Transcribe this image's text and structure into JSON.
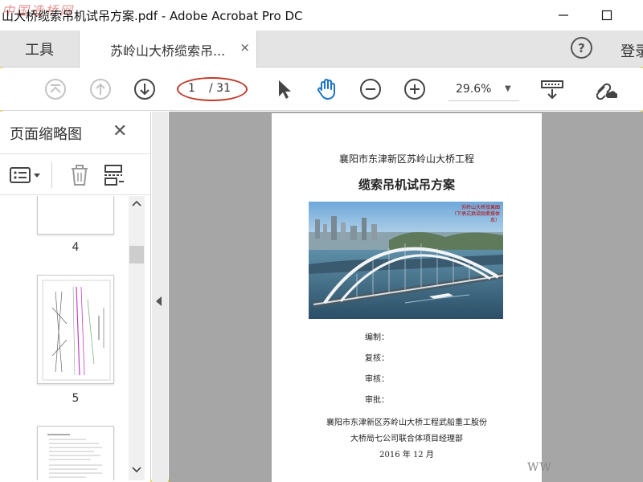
{
  "window": {
    "title": "山大桥缆索吊机试吊方案.pdf - Adobe Acrobat Pro DC",
    "watermark_top": "中国造桥网",
    "minimize_icon": "minimize-icon",
    "maximize_icon": "maximize-icon"
  },
  "tabs": {
    "tools_label": "工具",
    "doc_label": "苏岭山大桥缆索吊...",
    "close_glyph": "×",
    "help_glyph": "?",
    "login_label": "登录"
  },
  "toolbar": {
    "page_current": "1",
    "page_total": "/ 31",
    "zoom": "29.6%",
    "zoom_caret": "▼",
    "accent": "#c0392b",
    "hand_color": "#1a73c8"
  },
  "panel": {
    "title": "页面缩略图",
    "close_glyph": "✕",
    "thumbnails": [
      {
        "label": "4"
      },
      {
        "label": "5"
      }
    ]
  },
  "document": {
    "org": "襄阳市东津新区苏岭山大桥工程",
    "title": "缆索吊机试吊方案",
    "photo_caption_1": "苏岭山大桥效果图",
    "photo_caption_2": "（下承式拱梁刚柔撑体系）",
    "fields": [
      "编制：",
      "复核：",
      "审核：",
      "审批："
    ],
    "footer_line1": "襄阳市东津新区苏岭山大桥工程武船重工股份",
    "footer_line2": "大桥局七公司联合体项目经理部",
    "footer_date": "2016 年 12 月"
  },
  "watermark_bottom": "WW"
}
